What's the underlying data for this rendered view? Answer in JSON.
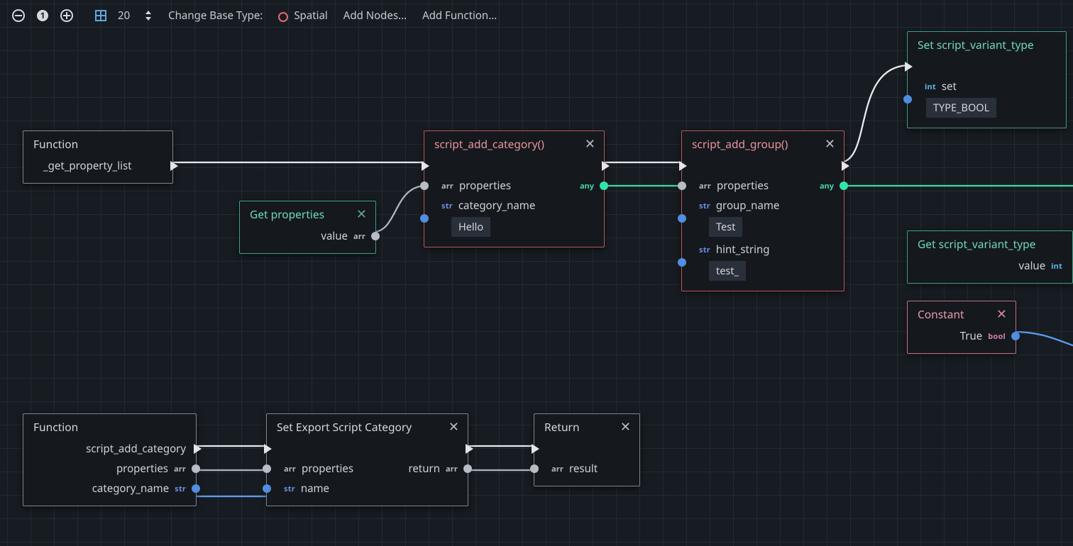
{
  "toolbar": {
    "zoom_value": "20",
    "change_base_type_label": "Change Base Type:",
    "base_type": "Spatial",
    "add_nodes_label": "Add Nodes...",
    "add_function_label": "Add Function..."
  },
  "nodes": {
    "func1": {
      "title": "Function",
      "entry": "_get_property_list"
    },
    "get_props": {
      "title": "Get properties",
      "out_label": "value",
      "out_type": "arr"
    },
    "add_cat": {
      "title": "script_add_category()",
      "p1_label": "properties",
      "p1_type": "arr",
      "p2_label": "category_name",
      "p2_type": "str",
      "p2_value": "Hello",
      "out_type": "any"
    },
    "add_group": {
      "title": "script_add_group()",
      "p1_label": "properties",
      "p1_type": "arr",
      "p2_label": "group_name",
      "p2_type": "str",
      "p2_value": "Test",
      "p3_label": "hint_string",
      "p3_type": "str",
      "p3_value": "test_",
      "out_type": "any"
    },
    "set_variant": {
      "title": "Set script_variant_type",
      "in_label": "set",
      "in_type": "int",
      "in_value": "TYPE_BOOL"
    },
    "get_variant": {
      "title": "Get script_variant_type",
      "out_label": "value",
      "out_type": "int"
    },
    "const_true": {
      "title": "Constant",
      "out_label": "True",
      "out_type": "bool"
    },
    "func2": {
      "title": "Function",
      "entry": "script_add_category",
      "p1_label": "properties",
      "p1_type": "arr",
      "p2_label": "category_name",
      "p2_type": "str"
    },
    "set_export": {
      "title": "Set Export Script Category",
      "p1_label": "properties",
      "p1_type": "arr",
      "p2_label": "name",
      "p2_type": "str",
      "out_label": "return",
      "out_type": "arr"
    },
    "return": {
      "title": "Return",
      "p1_label": "result",
      "p1_type": "arr"
    }
  }
}
